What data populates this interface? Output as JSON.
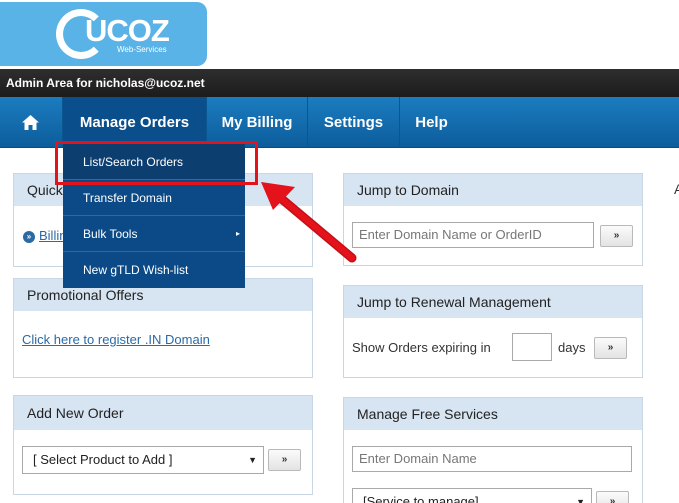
{
  "logo": {
    "name": "UCOZ",
    "sub": "Web-Services"
  },
  "admin_bar": {
    "text": "Admin Area for nicholas@ucoz.net"
  },
  "nav": {
    "home_icon": "home-icon",
    "items": [
      "Manage Orders",
      "My Billing",
      "Settings",
      "Help"
    ]
  },
  "dropdown": {
    "items": [
      "List/Search Orders",
      "Transfer Domain",
      "Bulk Tools",
      "New gTLD Wish-list"
    ],
    "submenu_indicator": "▸"
  },
  "quick": {
    "title": "Quick",
    "link": "Billin"
  },
  "promo": {
    "title": "Promotional Offers",
    "link": "Click here to register .IN Domain"
  },
  "add_order": {
    "title": "Add New Order",
    "select_value": "[ Select Product to Add ]",
    "button": "»"
  },
  "jump_domain": {
    "title": "Jump to Domain",
    "placeholder": "Enter Domain Name or OrderID",
    "button": "»"
  },
  "renewal": {
    "title": "Jump to Renewal Management",
    "label_before": "Show Orders expiring in",
    "label_after": "days",
    "button": "»"
  },
  "free_services": {
    "title": "Manage Free Services",
    "placeholder": "Enter Domain Name",
    "select_value": "[Service to manage]",
    "button": "»"
  },
  "edge": {
    "letter": "A"
  },
  "colors": {
    "nav": "#1b7cc0",
    "dropdown": "#0b4a86",
    "highlight": "#e3121b",
    "panel_head": "#d7e4f2"
  }
}
